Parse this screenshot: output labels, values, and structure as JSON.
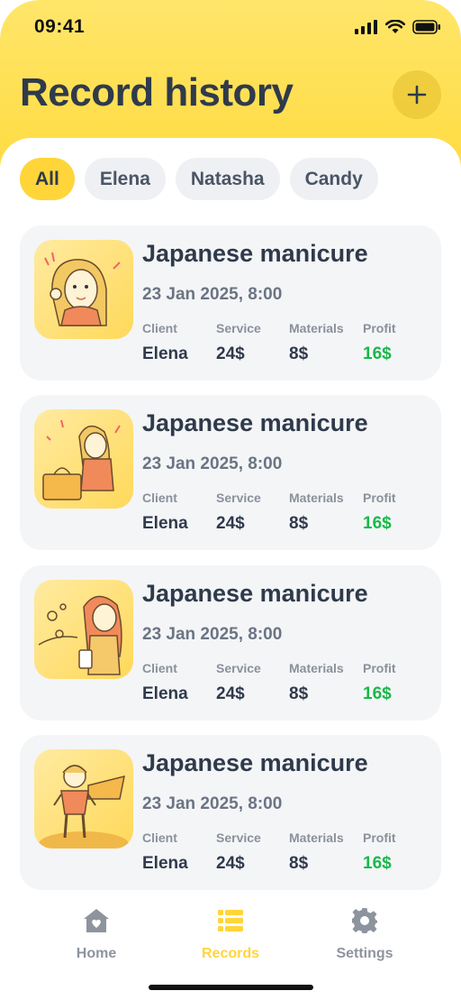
{
  "status_bar": {
    "time": "09:41"
  },
  "header": {
    "title": "Record history",
    "add_label": "+"
  },
  "filters": [
    {
      "label": "All",
      "active": true
    },
    {
      "label": "Elena",
      "active": false
    },
    {
      "label": "Natasha",
      "active": false
    },
    {
      "label": "Candy",
      "active": false
    }
  ],
  "column_labels": {
    "client": "Client",
    "service": "Service",
    "materials": "Materials",
    "profit": "Profit"
  },
  "records": [
    {
      "title": "Japanese manicure",
      "date": "23 Jan 2025, 8:00",
      "client": "Elena",
      "service": "24$",
      "materials": "8$",
      "profit": "16$"
    },
    {
      "title": "Japanese manicure",
      "date": "23 Jan 2025, 8:00",
      "client": "Elena",
      "service": "24$",
      "materials": "8$",
      "profit": "16$"
    },
    {
      "title": "Japanese manicure",
      "date": "23 Jan 2025, 8:00",
      "client": "Elena",
      "service": "24$",
      "materials": "8$",
      "profit": "16$"
    },
    {
      "title": "Japanese manicure",
      "date": "23 Jan 2025, 8:00",
      "client": "Elena",
      "service": "24$",
      "materials": "8$",
      "profit": "16$"
    }
  ],
  "tabbar": {
    "home": "Home",
    "records": "Records",
    "settings": "Settings"
  },
  "colors": {
    "accent": "#ffd53a",
    "profit": "#19b84a",
    "text": "#2f3a4b"
  },
  "icons": [
    "signal-icon",
    "wifi-icon",
    "battery-icon",
    "plus-icon",
    "home-icon",
    "records-icon",
    "settings-icon"
  ]
}
